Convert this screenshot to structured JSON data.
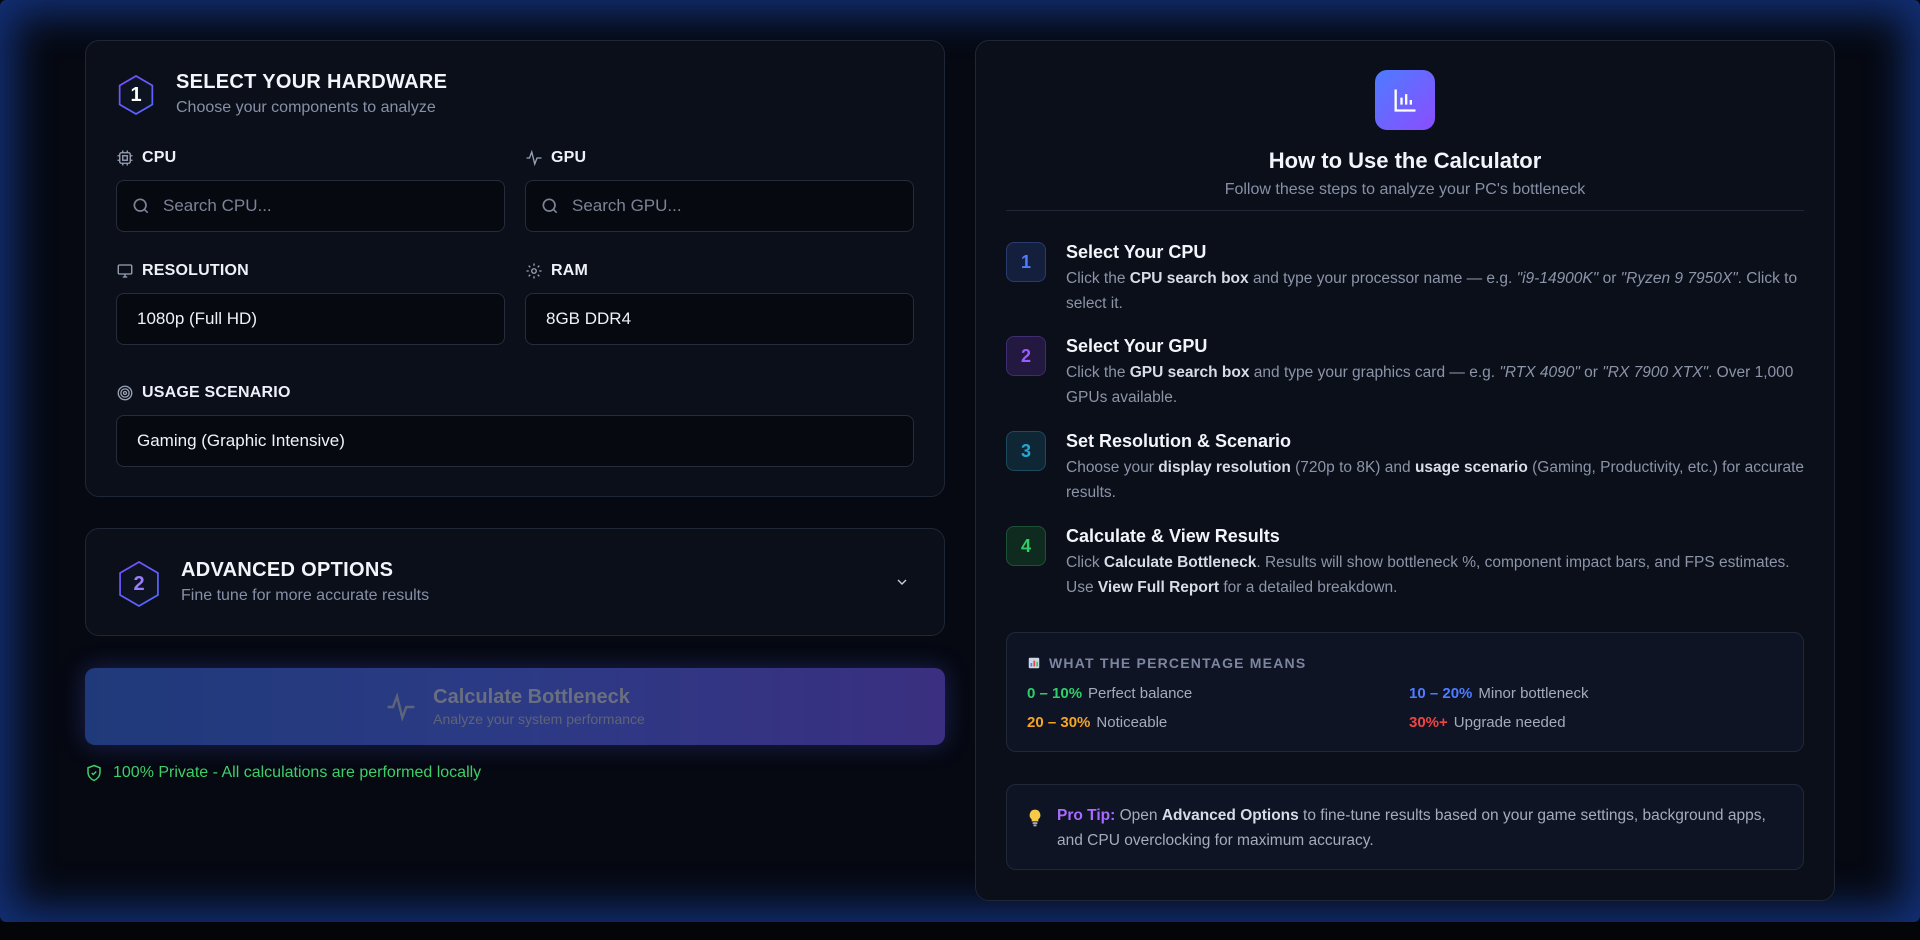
{
  "hardware": {
    "section_number": "1",
    "title": "SELECT YOUR HARDWARE",
    "subtitle": "Choose your components to analyze",
    "cpu": {
      "label": "CPU",
      "placeholder": "Search CPU..."
    },
    "gpu": {
      "label": "GPU",
      "placeholder": "Search GPU..."
    },
    "resolution": {
      "label": "RESOLUTION",
      "value": "1080p (Full HD)"
    },
    "ram": {
      "label": "RAM",
      "value": "8GB DDR4"
    },
    "usage": {
      "label": "USAGE SCENARIO",
      "value": "Gaming (Graphic Intensive)"
    }
  },
  "advanced": {
    "section_number": "2",
    "title": "ADVANCED OPTIONS",
    "subtitle": "Fine tune for more accurate results"
  },
  "calculate": {
    "label": "Calculate Bottleneck",
    "sublabel": "Analyze your system performance"
  },
  "privacy": "100% Private - All calculations are performed locally",
  "guide": {
    "title": "How to Use the Calculator",
    "subtitle": "Follow these steps to analyze your PC's bottleneck",
    "steps": [
      {
        "num": "1",
        "title": "Select Your CPU",
        "color": "#4f7cff"
      },
      {
        "num": "2",
        "title": "Select Your GPU",
        "color": "#9a5cff"
      },
      {
        "num": "3",
        "title": "Set Resolution & Scenario",
        "color": "#22a8d6"
      },
      {
        "num": "4",
        "title": "Calculate & View Results",
        "color": "#2fcf68"
      }
    ],
    "step1": {
      "t1": "Click the ",
      "b1": "CPU search box",
      "t2": " and type your processor name — e.g. ",
      "i1": "\"i9-14900K\"",
      "t3": " or ",
      "i2": "\"Ryzen 9 7950X\"",
      "t4": ". Click to select it."
    },
    "step2": {
      "t1": "Click the ",
      "b1": "GPU search box",
      "t2": " and type your graphics card — e.g. ",
      "i1": "\"RTX 4090\"",
      "t3": " or ",
      "i2": "\"RX 7900 XTX\"",
      "t4": ". Over 1,000 GPUs available."
    },
    "step3": {
      "t1": "Choose your ",
      "b1": "display resolution",
      "t2": " (720p to 8K) and ",
      "b2": "usage scenario",
      "t3": " (Gaming, Productivity, etc.) for accurate results."
    },
    "step4": {
      "t1": "Click ",
      "b1": "Calculate Bottleneck",
      "t2": ". Results will show bottleneck %, component impact bars, and FPS estimates. Use ",
      "b2": "View Full Report",
      "t3": " for a detailed breakdown."
    },
    "percentages": {
      "heading": "WHAT THE PERCENTAGE MEANS",
      "items": [
        {
          "range": "0 – 10%",
          "text": "Perfect balance",
          "color": "#2fcf68"
        },
        {
          "range": "10 – 20%",
          "text": "Minor bottleneck",
          "color": "#4f7cff"
        },
        {
          "range": "20 – 30%",
          "text": "Noticeable",
          "color": "#f5a524"
        },
        {
          "range": "30%+",
          "text": "Upgrade needed",
          "color": "#ef4444"
        }
      ]
    },
    "tip": {
      "label": "Pro Tip:",
      "t1": " Open ",
      "b1": "Advanced Options",
      "t2": " to fine-tune results based on your game settings, background apps, and CPU overclocking for maximum accuracy."
    }
  }
}
